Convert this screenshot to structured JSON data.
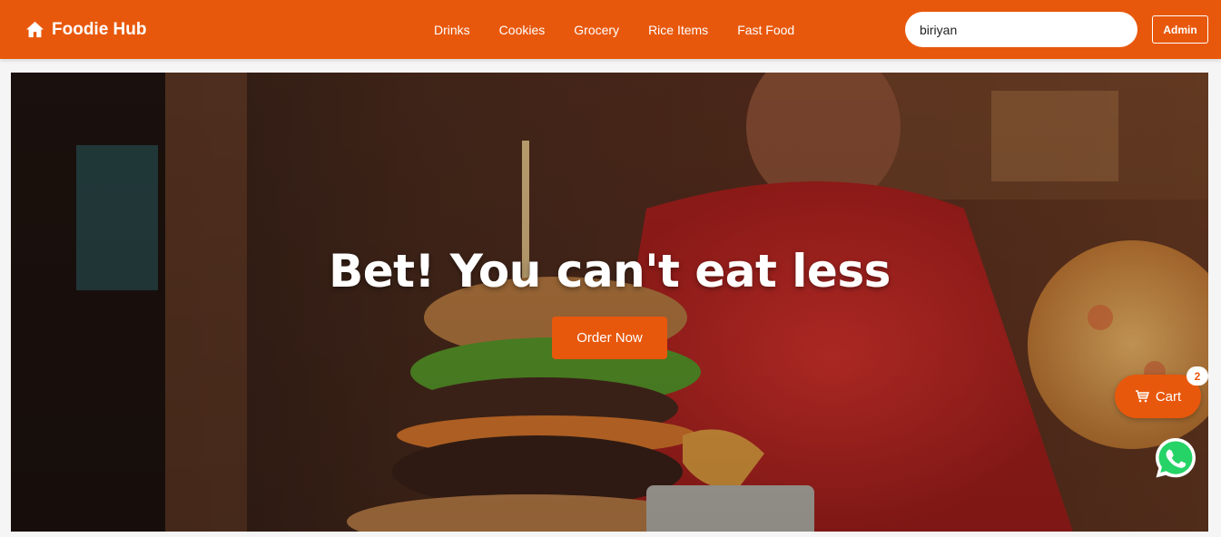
{
  "navbar": {
    "brand_icon": "home-icon",
    "brand": "Foodie Hub",
    "links": [
      "Drinks",
      "Cookies",
      "Grocery",
      "Rice Items",
      "Fast Food"
    ],
    "search_value": "biriyan",
    "admin_label": "Admin"
  },
  "hero": {
    "title": "Bet! You can't eat less",
    "cta_label": "Order Now"
  },
  "cart": {
    "icon": "cart-icon",
    "label": "Cart",
    "count": "2"
  },
  "whatsapp": {
    "icon": "whatsapp-icon"
  },
  "colors": {
    "accent": "#e8580c",
    "whatsapp": "#25d366"
  }
}
